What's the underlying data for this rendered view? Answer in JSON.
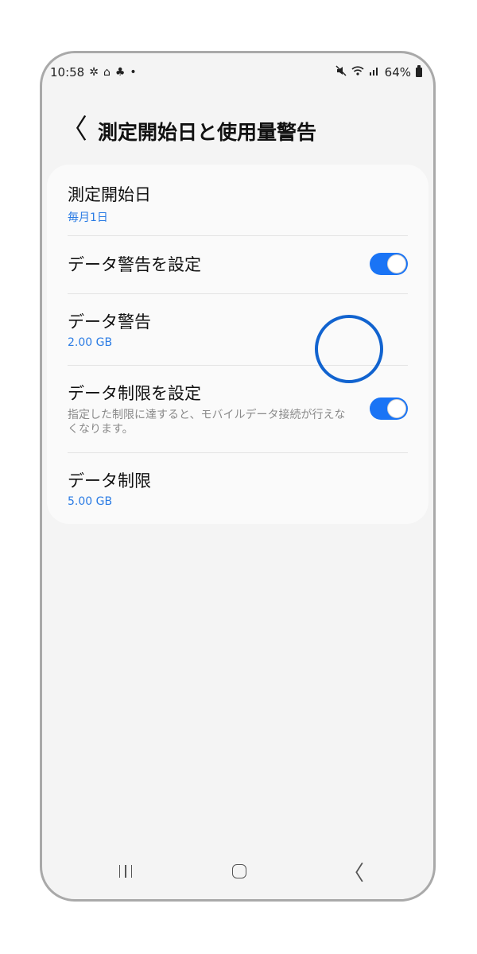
{
  "status_bar": {
    "time": "10:58",
    "left_icons": [
      "✲",
      "⌂",
      "♣",
      "•"
    ],
    "battery": "64%"
  },
  "header": {
    "back_glyph": "〈",
    "title": "測定開始日と使用量警告"
  },
  "settings": [
    {
      "title": "測定開始日",
      "subtitle": "毎月1日"
    },
    {
      "title": "データ警告を設定",
      "toggle_on": true
    },
    {
      "title": "データ警告",
      "subtitle": "2.00 GB"
    },
    {
      "title": "データ制限を設定",
      "description": "指定した制限に達すると、モバイルデータ接続が行えなくなります。",
      "toggle_on": true
    },
    {
      "title": "データ制限",
      "subtitle": "5.00 GB"
    }
  ],
  "nav": {
    "back_glyph": "〈"
  },
  "colors": {
    "accent": "#1a74f5",
    "highlight": "#1163cf",
    "link": "#2a7be4"
  }
}
